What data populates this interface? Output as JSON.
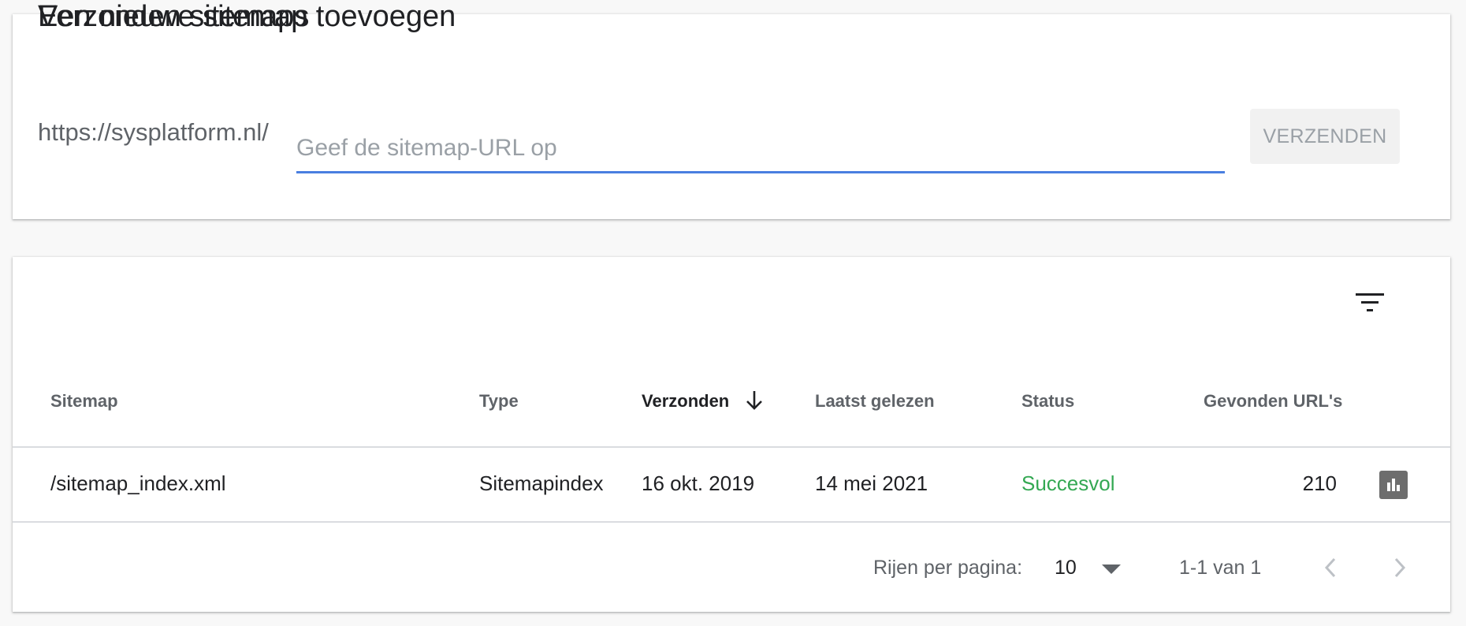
{
  "add_card": {
    "title": "Een nieuwe sitemap toevoegen",
    "url_prefix": "https://sysplatform.nl/",
    "input_placeholder": "Geef de sitemap-URL op",
    "input_value": "",
    "send_label": "VERZENDEN"
  },
  "list_card": {
    "title": "Verzonden sitemaps",
    "filter_icon": "filter-icon",
    "columns": [
      "Sitemap",
      "Type",
      "Verzonden",
      "Laatst gelezen",
      "Status",
      "Gevonden URL's"
    ],
    "sorted_column": "Verzonden",
    "sort_direction": "descending",
    "rows": [
      {
        "sitemap": "/sitemap_index.xml",
        "type": "Sitemapindex",
        "submitted": "16 okt. 2019",
        "last_read": "14 mei 2021",
        "status": "Succesvol",
        "urls_found": "210",
        "action_icon": "bar-chart-icon"
      }
    ],
    "footer": {
      "rows_per_page_label": "Rijen per pagina:",
      "rows_per_page_value": "10",
      "range_label": "1-1 van 1"
    }
  },
  "colors": {
    "accent": "#4a7fe0",
    "success": "#34a853",
    "background": "#f8f8f8"
  }
}
